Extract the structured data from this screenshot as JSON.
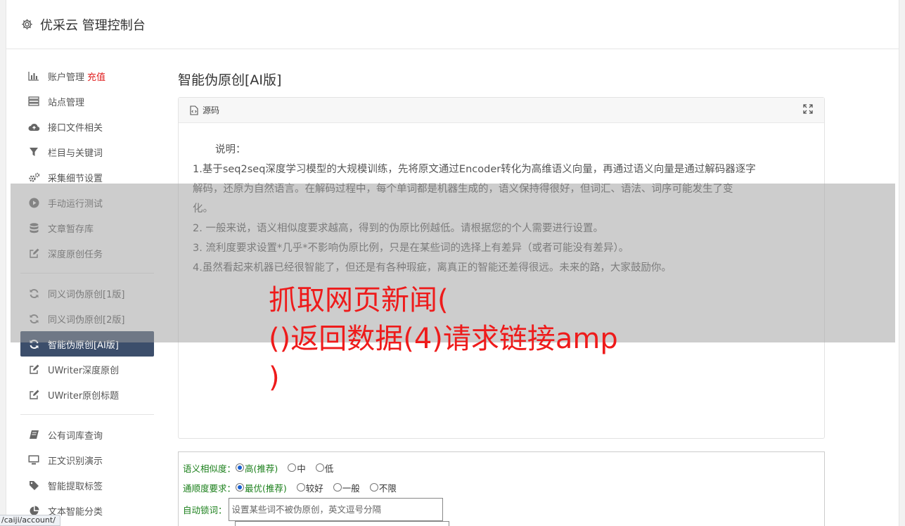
{
  "header": {
    "title": "优采云 管理控制台",
    "icon": "gear-icon"
  },
  "sidebar": {
    "items": [
      {
        "label": "账户管理",
        "badge": "充值",
        "icon": "bar-chart-icon"
      },
      {
        "label": "站点管理",
        "icon": "server-icon"
      },
      {
        "label": "接口文件相关",
        "icon": "cloud-upload-icon"
      },
      {
        "label": "栏目与关键词",
        "icon": "filter-icon"
      },
      {
        "label": "采集细节设置",
        "icon": "cogs-icon"
      },
      {
        "label": "手动运行测试",
        "icon": "play-circle-icon"
      },
      {
        "label": "文章暂存库",
        "icon": "database-icon"
      },
      {
        "label": "深度原创任务",
        "icon": "edit-icon"
      },
      {
        "label": "同义词伪原创[1版]",
        "icon": "refresh-icon"
      },
      {
        "label": "同义词伪原创[2版]",
        "icon": "refresh-icon"
      },
      {
        "label": "智能伪原创[AI版]",
        "icon": "refresh-icon",
        "active": true
      },
      {
        "label": "UWriter深度原创",
        "icon": "edit-icon"
      },
      {
        "label": "UWriter原创标题",
        "icon": "edit-icon"
      },
      {
        "label": "公有词库查询",
        "icon": "book-icon"
      },
      {
        "label": "正文识别演示",
        "icon": "monitor-icon"
      },
      {
        "label": "智能提取标签",
        "icon": "tag-icon"
      },
      {
        "label": "文本智能分类",
        "icon": "pie-chart-icon"
      }
    ]
  },
  "main": {
    "title": "智能伪原创[AI版]",
    "panel": {
      "header": "源码",
      "lines": [
        "说明：",
        "1.基于seq2seq深度学习模型的大规模训练，先将原文通过Encoder转化为高维语义向量，再通过语义向量是通过解码器逐字",
        "解码，还原为自然语言。在解码过程中，每个单词都是机器生成的，语义保持得很好，但词汇、语法、词序可能发生了变",
        "化。",
        "2. 一般来说，语义相似度要求越高，得到的伪原比例越低。请根据您的个人需要进行设置。",
        "3. 流利度要求设置*几乎*不影响伪原比例，只是在某些词的选择上有差异（或者可能没有差异）。",
        "4.虽然看起来机器已经很智能了，但还是有各种瑕疵，离真正的智能还差得很远。未来的路，大家鼓励你。"
      ]
    },
    "form": {
      "similarity_label": "语义相似度：",
      "similarity_options": [
        "高(推荐)",
        "中",
        "低"
      ],
      "similarity_selected": "高(推荐)",
      "fluency_label": "通顺度要求：",
      "fluency_options": [
        "最优(推荐)",
        "较好",
        "一般",
        "不限"
      ],
      "fluency_selected": "最优(推荐)",
      "lock_label": "自动锁词：",
      "lock_placeholder": "设置某些词不被伪原创，英文逗号分隔"
    }
  },
  "overlay_caption": "抓取网页新闻(\n()返回数据(4)请求链接amp\n)",
  "status_url": "/caiji/account/",
  "colors": {
    "accent": "#3c4e6b",
    "badge": "#e02020",
    "caption": "#ee1b1b",
    "label_green": "#1a7f1a"
  }
}
